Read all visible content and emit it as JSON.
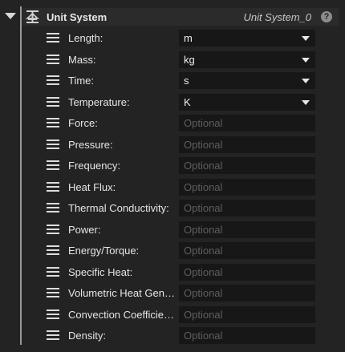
{
  "header": {
    "title": "Unit System",
    "instance_name": "Unit System_0",
    "help_glyph": "?",
    "icon": "unit-system-icon"
  },
  "rows": [
    {
      "label": "Length:",
      "type": "select",
      "value": "m"
    },
    {
      "label": "Mass:",
      "type": "select",
      "value": "kg"
    },
    {
      "label": "Time:",
      "type": "select",
      "value": "s"
    },
    {
      "label": "Temperature:",
      "type": "select",
      "value": "K"
    },
    {
      "label": "Force:",
      "type": "input",
      "placeholder": "Optional"
    },
    {
      "label": "Pressure:",
      "type": "input",
      "placeholder": "Optional"
    },
    {
      "label": "Frequency:",
      "type": "input",
      "placeholder": "Optional"
    },
    {
      "label": "Heat Flux:",
      "type": "input",
      "placeholder": "Optional"
    },
    {
      "label": "Thermal Conductivity:",
      "type": "input",
      "placeholder": "Optional"
    },
    {
      "label": "Power:",
      "type": "input",
      "placeholder": "Optional"
    },
    {
      "label": "Energy/Torque:",
      "type": "input",
      "placeholder": "Optional"
    },
    {
      "label": "Specific Heat:",
      "type": "input",
      "placeholder": "Optional"
    },
    {
      "label": "Volumetric Heat Gen…",
      "type": "input",
      "placeholder": "Optional"
    },
    {
      "label": "Convection Coefficie…",
      "type": "input",
      "placeholder": "Optional"
    },
    {
      "label": "Density:",
      "type": "input",
      "placeholder": "Optional"
    }
  ],
  "colors": {
    "background": "#232323",
    "header": "#2b2b2b",
    "field": "#171717",
    "text": "#e6e6e6",
    "placeholder": "#5e5e5e"
  }
}
